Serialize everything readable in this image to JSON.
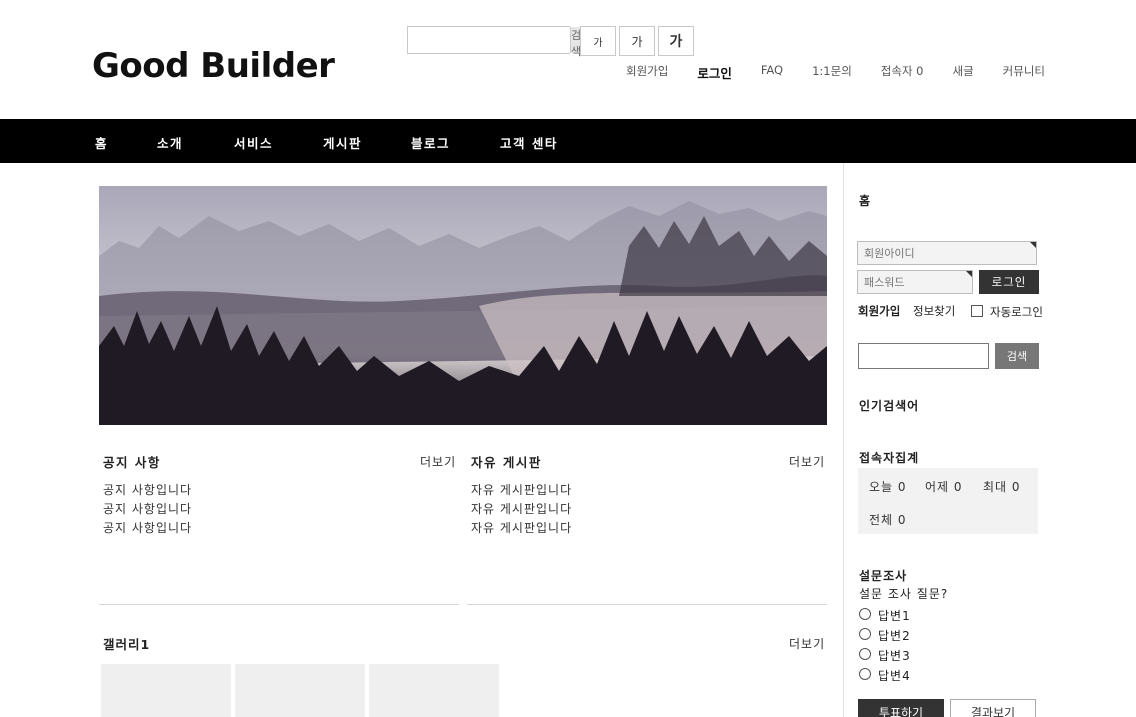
{
  "header": {
    "logo": "Good  Builder",
    "search_button": "검색",
    "font_sizes": [
      "가",
      "가",
      "가"
    ],
    "links": [
      "회원가입",
      "로그인",
      "FAQ",
      "1:1문의",
      "접속자 0",
      "새글",
      "커뮤니티"
    ]
  },
  "nav": {
    "items": [
      "홈",
      "소개",
      "서비스",
      "게시판",
      "블로그",
      "고객 센타"
    ]
  },
  "boards": [
    {
      "title": "공지 사항",
      "more": "더보기",
      "items": [
        "공지 사항입니다",
        "공지 사항입니다",
        "공지 사항입니다"
      ]
    },
    {
      "title": "자유 게시판",
      "more": "더보기",
      "items": [
        "자유 게시판입니다",
        "자유 게시판입니다",
        "자유 게시판입니다"
      ]
    }
  ],
  "gallery": {
    "title": "갤러리1",
    "more": "더보기"
  },
  "sidebar": {
    "home": "홈",
    "id_placeholder": "회원아이디",
    "pw_placeholder": "패스워드",
    "login_button": "로그인",
    "join": "회원가입",
    "find_info": "정보찾기",
    "auto_login": "자동로그인",
    "search_button": "검색",
    "popular_title": "인기검색어",
    "stats_title": "접속자집계",
    "stats": {
      "today": "오늘 0",
      "yesterday": "어제 0",
      "max": "최대 0",
      "total": "전체 0"
    },
    "poll_title": "설문조사",
    "poll_question": "설문 조사 질문?",
    "poll_options": [
      "답변1",
      "답변2",
      "답변3",
      "답변4"
    ],
    "vote_button": "투표하기",
    "result_button": "결과보기"
  },
  "colors": {
    "nav_bg": "#000000",
    "dark_button": "#333333",
    "gray_button": "#777777"
  }
}
